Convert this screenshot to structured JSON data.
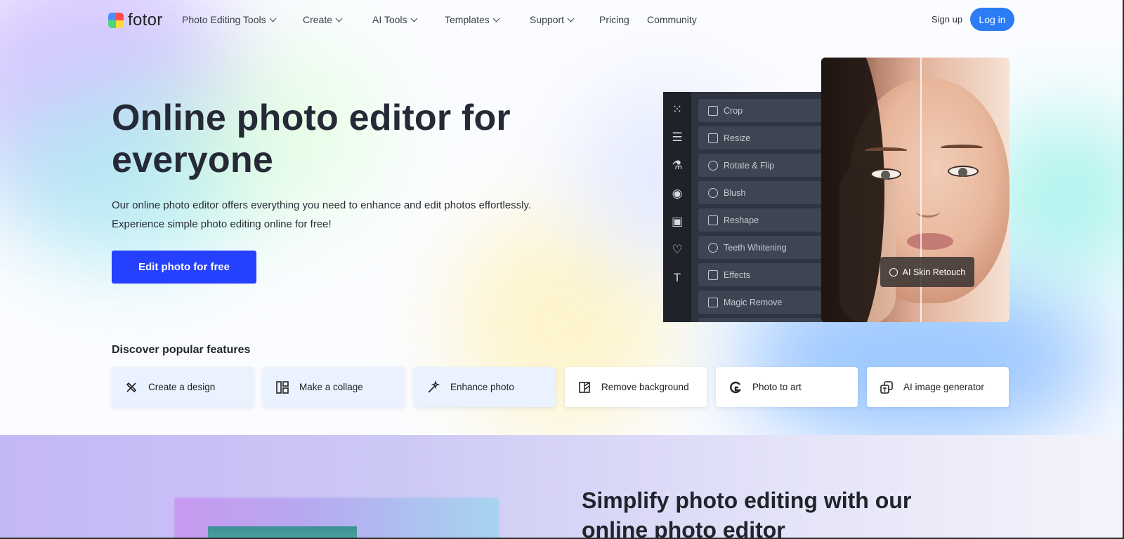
{
  "brand": {
    "name": "fotor"
  },
  "nav": {
    "items": [
      {
        "label": "Photo Editing Tools",
        "has_dropdown": true
      },
      {
        "label": "Create",
        "has_dropdown": true
      },
      {
        "label": "AI Tools",
        "has_dropdown": true
      },
      {
        "label": "Templates",
        "has_dropdown": true
      },
      {
        "label": "Support",
        "has_dropdown": true
      },
      {
        "label": "Pricing",
        "has_dropdown": false
      },
      {
        "label": "Community",
        "has_dropdown": false
      }
    ],
    "signup": "Sign up",
    "login": "Log in"
  },
  "hero": {
    "title_line1": "Online photo editor for",
    "title_line2": "everyone",
    "desc_line1": "Our online photo editor offers everything you need to enhance and edit photos effortlessly.",
    "desc_line2": "Experience simple photo editing online for free!",
    "cta": "Edit photo for free"
  },
  "editor": {
    "rail_icons": [
      "grid-icon",
      "sliders-icon",
      "flask-icon",
      "eye-icon",
      "frame-icon",
      "shapes-icon",
      "text-icon"
    ],
    "menu": [
      {
        "label": "Crop",
        "icon": "crop-icon"
      },
      {
        "label": "Resize",
        "icon": "resize-icon"
      },
      {
        "label": "Rotate & Flip",
        "icon": "rotate-icon"
      },
      {
        "label": "Blush",
        "icon": "blush-icon"
      },
      {
        "label": "Reshape",
        "icon": "reshape-icon"
      },
      {
        "label": "Teeth Whitening",
        "icon": "teeth-icon"
      },
      {
        "label": "Effects",
        "icon": "effects-icon"
      },
      {
        "label": "Magic Remove",
        "icon": "eraser-icon"
      }
    ],
    "badge": "AI Skin Retouch"
  },
  "features": {
    "title": "Discover popular features",
    "cards": [
      {
        "label": "Create a design",
        "icon": "design-icon"
      },
      {
        "label": "Make a collage",
        "icon": "collage-icon"
      },
      {
        "label": "Enhance photo",
        "icon": "enhance-icon"
      },
      {
        "label": "Remove background",
        "icon": "remove-bg-icon"
      },
      {
        "label": "Photo to art",
        "icon": "photo-art-icon"
      },
      {
        "label": "AI image generator",
        "icon": "ai-generator-icon"
      }
    ]
  },
  "section2": {
    "title_line1": "Simplify photo editing with our",
    "title_line2": "online photo editor"
  },
  "colors": {
    "primary_cta": "#2640ff",
    "login_button": "#2b7cf5",
    "editor_panel": "#2e3440"
  }
}
